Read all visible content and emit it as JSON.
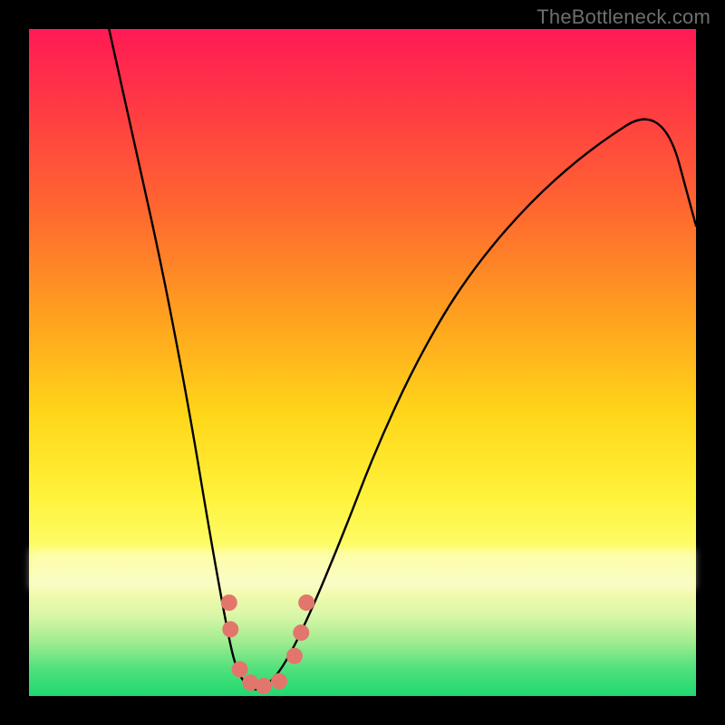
{
  "watermark": "TheBottleneck.com",
  "chart_data": {
    "type": "line",
    "title": "",
    "xlabel": "",
    "ylabel": "",
    "xlim": [
      0,
      1
    ],
    "ylim": [
      0,
      1
    ],
    "series": [
      {
        "name": "curve",
        "x": [
          0.12,
          0.16,
          0.2,
          0.24,
          0.27,
          0.295,
          0.31,
          0.33,
          0.35,
          0.38,
          0.42,
          0.47,
          0.52,
          0.58,
          0.65,
          0.74,
          0.84,
          0.95,
          1.0
        ],
        "y": [
          1.0,
          0.82,
          0.64,
          0.43,
          0.25,
          0.11,
          0.04,
          0.01,
          0.01,
          0.04,
          0.12,
          0.24,
          0.37,
          0.5,
          0.62,
          0.73,
          0.82,
          0.89,
          0.705
        ]
      }
    ],
    "markers": {
      "name": "highlight-dots",
      "color": "#e3766c",
      "points": [
        {
          "x": 0.3,
          "y": 0.14
        },
        {
          "x": 0.302,
          "y": 0.1
        },
        {
          "x": 0.316,
          "y": 0.04
        },
        {
          "x": 0.332,
          "y": 0.02
        },
        {
          "x": 0.352,
          "y": 0.015
        },
        {
          "x": 0.375,
          "y": 0.022
        },
        {
          "x": 0.398,
          "y": 0.06
        },
        {
          "x": 0.408,
          "y": 0.095
        },
        {
          "x": 0.416,
          "y": 0.14
        }
      ]
    },
    "background_gradient": {
      "top": "#ff1a55",
      "mid": "#fff23a",
      "bottom": "#1fd96f"
    }
  }
}
